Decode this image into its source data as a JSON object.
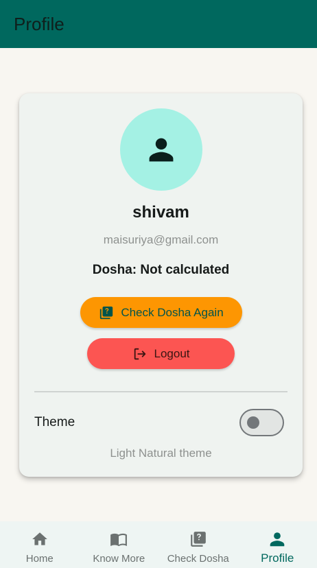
{
  "app_bar": {
    "title": "Profile"
  },
  "profile": {
    "avatar_icon": "person-icon",
    "name": "shivam",
    "email": "maisuriya@gmail.com",
    "dosha_status": "Dosha: Not calculated"
  },
  "actions": {
    "check_dosha_label": "Check Dosha Again",
    "check_dosha_icon": "quiz-icon",
    "logout_label": "Logout",
    "logout_icon": "logout-icon"
  },
  "settings": {
    "theme_label": "Theme",
    "theme_toggle_on": false,
    "theme_description": "Light Natural theme"
  },
  "bottom_nav": {
    "items": [
      {
        "label": "Home",
        "icon": "home-icon",
        "active": false
      },
      {
        "label": "Know More",
        "icon": "book-icon",
        "active": false
      },
      {
        "label": "Check Dosha",
        "icon": "quiz-icon",
        "active": false
      },
      {
        "label": "Profile",
        "icon": "person-icon",
        "active": true
      }
    ]
  },
  "colors": {
    "app_bar": "#00685e",
    "background": "#f8f6f1",
    "card": "#eff3f0",
    "avatar_bg": "#a4f1e4",
    "check_button": "#fd9602",
    "logout_button": "#fc5552",
    "nav_active": "#00685e"
  }
}
